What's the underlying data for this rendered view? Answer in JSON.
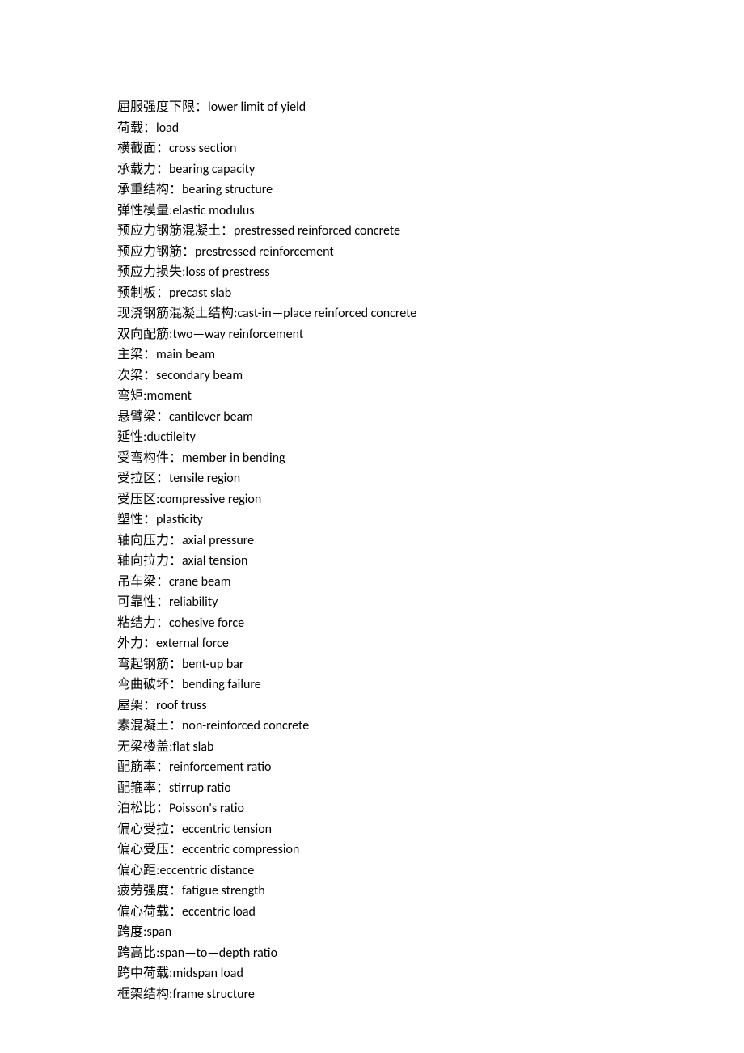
{
  "terms": [
    {
      "cn": "屈服强度下限：",
      "en": "lower limit of yield"
    },
    {
      "cn": "荷载：",
      "en": "load"
    },
    {
      "cn": "横截面：",
      "en": "cross section"
    },
    {
      "cn": "承载力：",
      "en": "bearing capacity"
    },
    {
      "cn": "承重结构：",
      "en": "bearing structure"
    },
    {
      "cn": "弹性模量:",
      "en": "elastic modulus"
    },
    {
      "cn": "预应力钢筋混凝土：",
      "en": "prestressed reinforced concrete"
    },
    {
      "cn": "预应力钢筋：",
      "en": "prestressed reinforcement"
    },
    {
      "cn": "预应力损失:",
      "en": "loss of prestress"
    },
    {
      "cn": "预制板：",
      "en": "precast slab"
    },
    {
      "cn": "现浇钢筋混凝土结构:",
      "en": "cast-in—place reinforced concrete"
    },
    {
      "cn": "双向配筋:",
      "en": "two—way reinforcement"
    },
    {
      "cn": "主梁：",
      "en": "main beam"
    },
    {
      "cn": "次梁：",
      "en": "secondary beam"
    },
    {
      "cn": "弯矩:",
      "en": "moment"
    },
    {
      "cn": "悬臂梁：",
      "en": "cantilever beam"
    },
    {
      "cn": "延性:",
      "en": "ductileity"
    },
    {
      "cn": "受弯构件：",
      "en": "member in bending"
    },
    {
      "cn": "受拉区：",
      "en": "tensile region"
    },
    {
      "cn": "受压区:",
      "en": "compressive region"
    },
    {
      "cn": "塑性：",
      "en": "plasticity"
    },
    {
      "cn": "轴向压力：",
      "en": "axial pressure"
    },
    {
      "cn": "轴向拉力：",
      "en": "axial tension"
    },
    {
      "cn": "吊车梁：",
      "en": "crane beam"
    },
    {
      "cn": "可靠性：",
      "en": "reliability"
    },
    {
      "cn": "粘结力：",
      "en": "cohesive force"
    },
    {
      "cn": "外力：",
      "en": "external force"
    },
    {
      "cn": "弯起钢筋：",
      "en": "bent-up bar"
    },
    {
      "cn": "弯曲破坏：",
      "en": "bending failure"
    },
    {
      "cn": "屋架：",
      "en": "roof truss"
    },
    {
      "cn": "素混凝土：",
      "en": "non-reinforced concrete"
    },
    {
      "cn": "无梁楼盖:",
      "en": "flat slab"
    },
    {
      "cn": "配筋率：",
      "en": "reinforcement ratio"
    },
    {
      "cn": "配箍率：",
      "en": "stirrup ratio"
    },
    {
      "cn": "泊松比：",
      "en": "Poisson's ratio"
    },
    {
      "cn": "偏心受拉：",
      "en": "eccentric tension"
    },
    {
      "cn": "偏心受压：",
      "en": "eccentric compression"
    },
    {
      "cn": "偏心距:",
      "en": "eccentric distance"
    },
    {
      "cn": "疲劳强度：",
      "en": "fatigue strength"
    },
    {
      "cn": "偏心荷载：",
      "en": "eccentric load"
    },
    {
      "cn": "跨度:",
      "en": "span"
    },
    {
      "cn": "跨高比:",
      "en": "span—to—depth ratio"
    },
    {
      "cn": "跨中荷载:",
      "en": "midspan load"
    },
    {
      "cn": "框架结构:",
      "en": "frame structure"
    }
  ]
}
